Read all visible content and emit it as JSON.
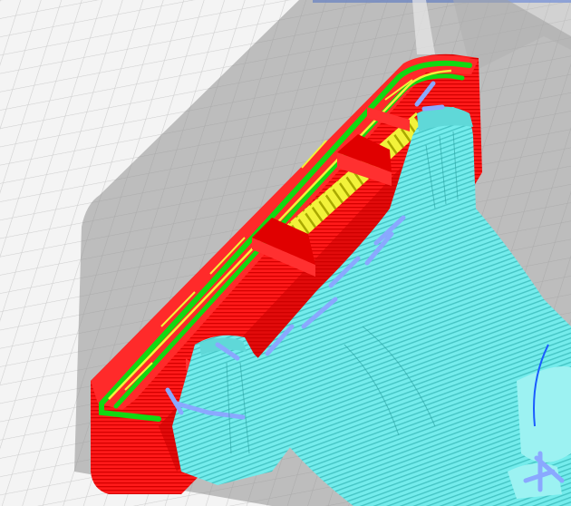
{
  "viewport": {
    "description_label": "",
    "colors": {
      "background": "#f4f4f4",
      "grid_line": "#cfcfcf",
      "ghost_model": "#9a9a9a",
      "wall_outer": "#ff1a1a",
      "wall_inner": "#12d812",
      "top_skin": "#f2f23a",
      "infill_dark": "#b8b800",
      "support": "#6fe8e8",
      "support_dark": "#38b8b8",
      "support_interface": "#8aa8ff",
      "selection_outline": "#1a5cff"
    },
    "icons": [
      "build-plate-grid",
      "ghost-model-preview",
      "toolpath-layers",
      "support-structure"
    ]
  }
}
